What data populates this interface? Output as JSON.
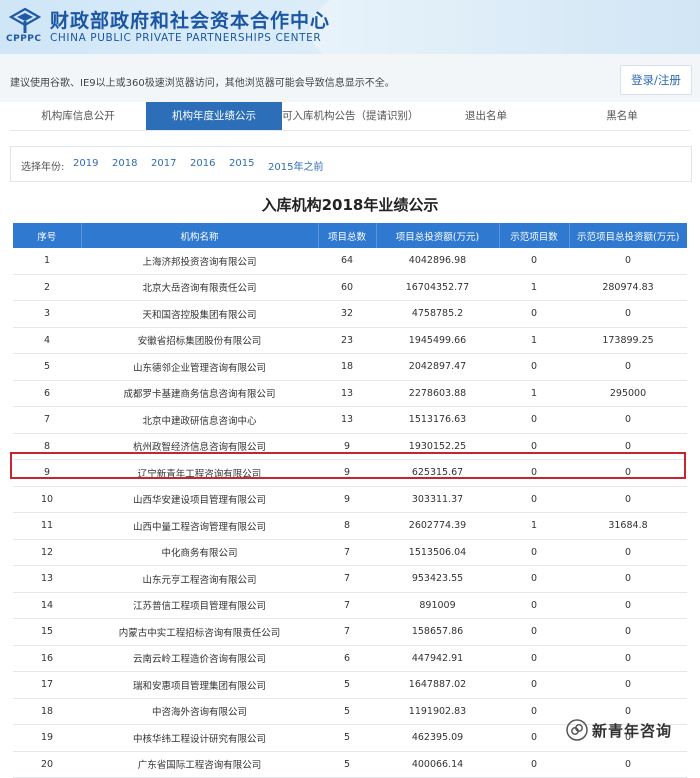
{
  "header": {
    "logo_text": "CPPPC",
    "title_cn": "财政部政府和社会资本合作中心",
    "title_en": "CHINA PUBLIC PRIVATE PARTNERSHIPS CENTER"
  },
  "notice": "建议使用谷歌、IE9以上或360极速浏览器访问，其他浏览器可能会导致信息显示不全。",
  "login": "登录/注册",
  "tabs": [
    {
      "label": "机构库信息公开"
    },
    {
      "label": "机构年度业绩公示"
    },
    {
      "label": "可入库机构公告（提请识别）"
    },
    {
      "label": "退出名单"
    },
    {
      "label": "黑名单"
    }
  ],
  "year_filter": {
    "label": "选择年份:",
    "years": [
      "2019",
      "2018",
      "2017",
      "2016",
      "2015",
      "2015年之前"
    ]
  },
  "table_title": "入库机构2018年业绩公示",
  "columns": [
    "序号",
    "机构名称",
    "项目总数",
    "项目总投资额(万元)",
    "示范项目数",
    "示范项目总投资额(万元)"
  ],
  "rows": [
    [
      "1",
      "上海济邦投资咨询有限公司",
      "64",
      "4042896.98",
      "0",
      "0"
    ],
    [
      "2",
      "北京大岳咨询有限责任公司",
      "60",
      "16704352.77",
      "1",
      "280974.83"
    ],
    [
      "3",
      "天和国咨控股集团有限公司",
      "32",
      "4758785.2",
      "0",
      "0"
    ],
    [
      "4",
      "安徽省招标集团股份有限公司",
      "23",
      "1945499.66",
      "1",
      "173899.25"
    ],
    [
      "5",
      "山东德邻企业管理咨询有限公司",
      "18",
      "2042897.47",
      "0",
      "0"
    ],
    [
      "6",
      "成都罗卡基建商务信息咨询有限公司",
      "13",
      "2278603.88",
      "1",
      "295000"
    ],
    [
      "7",
      "北京中建政研信息咨询中心",
      "13",
      "1513176.63",
      "0",
      "0"
    ],
    [
      "8",
      "杭州政智经济信息咨询有限公司",
      "9",
      "1930152.25",
      "0",
      "0"
    ],
    [
      "9",
      "辽宁新青年工程咨询有限公司",
      "9",
      "625315.67",
      "0",
      "0"
    ],
    [
      "10",
      "山西华安建设项目管理有限公司",
      "9",
      "303311.37",
      "0",
      "0"
    ],
    [
      "11",
      "山西中量工程咨询管理有限公司",
      "8",
      "2602774.39",
      "1",
      "31684.8"
    ],
    [
      "12",
      "中化商务有限公司",
      "7",
      "1513506.04",
      "0",
      "0"
    ],
    [
      "13",
      "山东元亨工程咨询有限公司",
      "7",
      "953423.55",
      "0",
      "0"
    ],
    [
      "14",
      "江苏普信工程项目管理有限公司",
      "7",
      "891009",
      "0",
      "0"
    ],
    [
      "15",
      "内蒙古中实工程招标咨询有限责任公司",
      "7",
      "158657.86",
      "0",
      "0"
    ],
    [
      "16",
      "云南云岭工程造价咨询有限公司",
      "6",
      "447942.91",
      "0",
      "0"
    ],
    [
      "17",
      "瑞和安惠项目管理集团有限公司",
      "5",
      "1647887.02",
      "0",
      "0"
    ],
    [
      "18",
      "中咨海外咨询有限公司",
      "5",
      "1191902.83",
      "0",
      "0"
    ],
    [
      "19",
      "中核华纬工程设计研究有限公司",
      "5",
      "462395.09",
      "0",
      "0"
    ],
    [
      "20",
      "广东省国际工程咨询有限公司",
      "5",
      "400066.14",
      "0",
      "0"
    ]
  ],
  "highlighted_row_index": 8,
  "watermark": "新青年咨询",
  "colors": {
    "accent": "#2f7ad0",
    "active_tab": "#2c6fb8",
    "highlight": "#c3262f",
    "brand": "#1b56a5"
  }
}
